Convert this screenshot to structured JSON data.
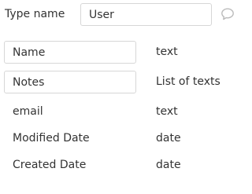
{
  "type_name": {
    "label": "Type name",
    "value": "User"
  },
  "icons": {
    "comment": "speech-bubble-icon"
  },
  "fields": [
    {
      "name": "Name",
      "type": "text",
      "editable": true
    },
    {
      "name": "Notes",
      "type": "List of texts",
      "editable": true
    },
    {
      "name": "email",
      "type": "text",
      "editable": false
    },
    {
      "name": "Modified Date",
      "type": "date",
      "editable": false
    },
    {
      "name": "Created Date",
      "type": "date",
      "editable": false
    }
  ],
  "colors": {
    "border": "#d7d7d7",
    "text": "#333333",
    "icon": "#bbbbbb"
  }
}
